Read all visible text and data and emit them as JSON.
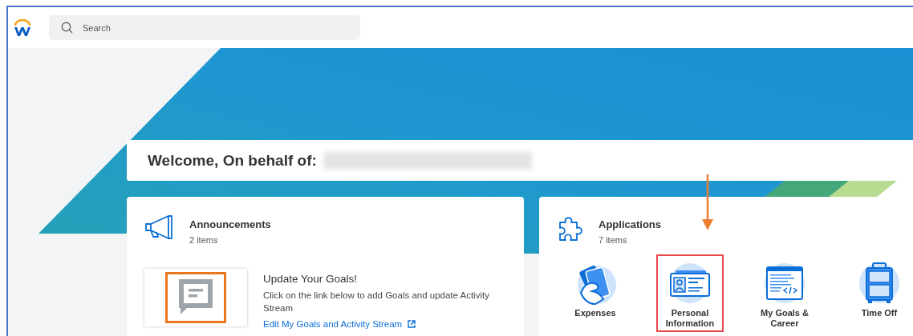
{
  "header": {
    "search": {
      "placeholder": "Search"
    }
  },
  "welcome": {
    "title": "Welcome, On behalf of:"
  },
  "announcements": {
    "title": "Announcements",
    "count": "2 items",
    "items": [
      {
        "title": "Update Your Goals!",
        "description": "Click on the link below to add Goals and update Activity Stream",
        "link": "Edit My Goals and Activity Stream",
        "highlighted": true
      }
    ]
  },
  "applications": {
    "title": "Applications",
    "count": "7 items",
    "apps": [
      {
        "label": "Expenses",
        "kind": "expenses",
        "highlighted": false
      },
      {
        "label": "Personal Information",
        "kind": "personal",
        "highlighted": true
      },
      {
        "label": "My Goals & Career",
        "kind": "goals",
        "highlighted": false
      },
      {
        "label": "Time Off",
        "kind": "timeoff",
        "highlighted": false
      }
    ]
  }
}
